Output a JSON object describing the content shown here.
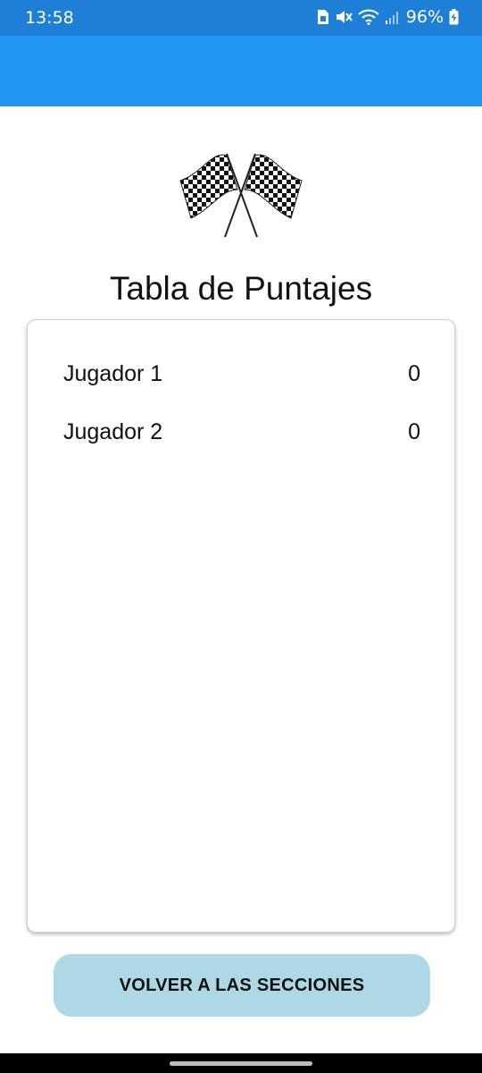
{
  "status_bar": {
    "time": "13:58",
    "battery_percent": "96%",
    "icons": [
      "sim-icon",
      "mute-icon",
      "wifi-icon",
      "signal-icon",
      "battery-charging-icon"
    ]
  },
  "app_bar": {
    "color": "#2196f3"
  },
  "header": {
    "image_icon": "checkered-flags-icon",
    "title": "Tabla de Puntajes"
  },
  "scores": {
    "rows": [
      {
        "name": "Jugador 1",
        "value": "0"
      },
      {
        "name": "Jugador 2",
        "value": "0"
      }
    ]
  },
  "actions": {
    "back_label": "VOLVER A LAS SECCIONES",
    "button_color": "#add8e6"
  }
}
